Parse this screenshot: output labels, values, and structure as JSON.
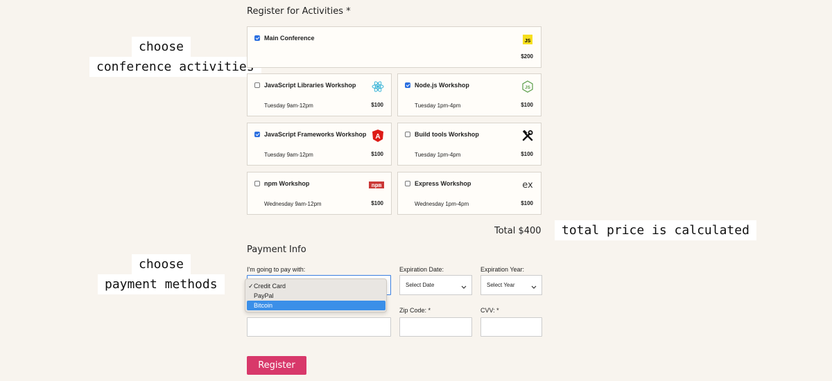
{
  "notes": {
    "activities_line1": "choose",
    "activities_line2": "conference activities",
    "total": "total price is calculated",
    "payment_line1": "choose",
    "payment_line2": "payment methods"
  },
  "activities": {
    "title": "Register for Activities *",
    "main": {
      "name": "Main Conference",
      "price": "$200",
      "checked": true,
      "icon": "javascript-icon",
      "icon_text": "JS"
    },
    "workshops": [
      {
        "name": "JavaScript Libraries Workshop",
        "time": "Tuesday 9am-12pm",
        "price": "$100",
        "checked": false,
        "icon": "react-icon"
      },
      {
        "name": "Node.js Workshop",
        "time": "Tuesday 1pm-4pm",
        "price": "$100",
        "checked": true,
        "icon": "nodejs-icon"
      },
      {
        "name": "JavaScript Frameworks Workshop",
        "time": "Tuesday 9am-12pm",
        "price": "$100",
        "checked": true,
        "icon": "angular-icon"
      },
      {
        "name": "Build tools Workshop",
        "time": "Tuesday 1pm-4pm",
        "price": "$100",
        "checked": false,
        "icon": "hammer-wrench-icon"
      },
      {
        "name": "npm Workshop",
        "time": "Wednesday 9am-12pm",
        "price": "$100",
        "checked": false,
        "icon": "npm-icon",
        "icon_text": "npm"
      },
      {
        "name": "Express Workshop",
        "time": "Wednesday 1pm-4pm",
        "price": "$100",
        "checked": false,
        "icon": "express-icon",
        "icon_text": "ex"
      }
    ],
    "total": "Total $400"
  },
  "payment": {
    "title": "Payment Info",
    "pay_with_label": "I'm going to pay with:",
    "options": [
      "Credit Card",
      "PayPal",
      "Bitcoin"
    ],
    "checked_option": "Credit Card",
    "highlighted_option": "Bitcoin",
    "check_mark": "✓",
    "exp_date_label": "Expiration Date:",
    "exp_date_value": "Select Date",
    "exp_year_label": "Expiration Year:",
    "exp_year_value": "Select Year",
    "zip_label": "Zip Code: *",
    "cvv_label": "CVV: *",
    "register_label": "Register"
  },
  "colors": {
    "accent": "#d8386a",
    "checkbox": "#2b6fe0",
    "highlight": "#3b8fe8",
    "background": "#f8f4ee"
  }
}
